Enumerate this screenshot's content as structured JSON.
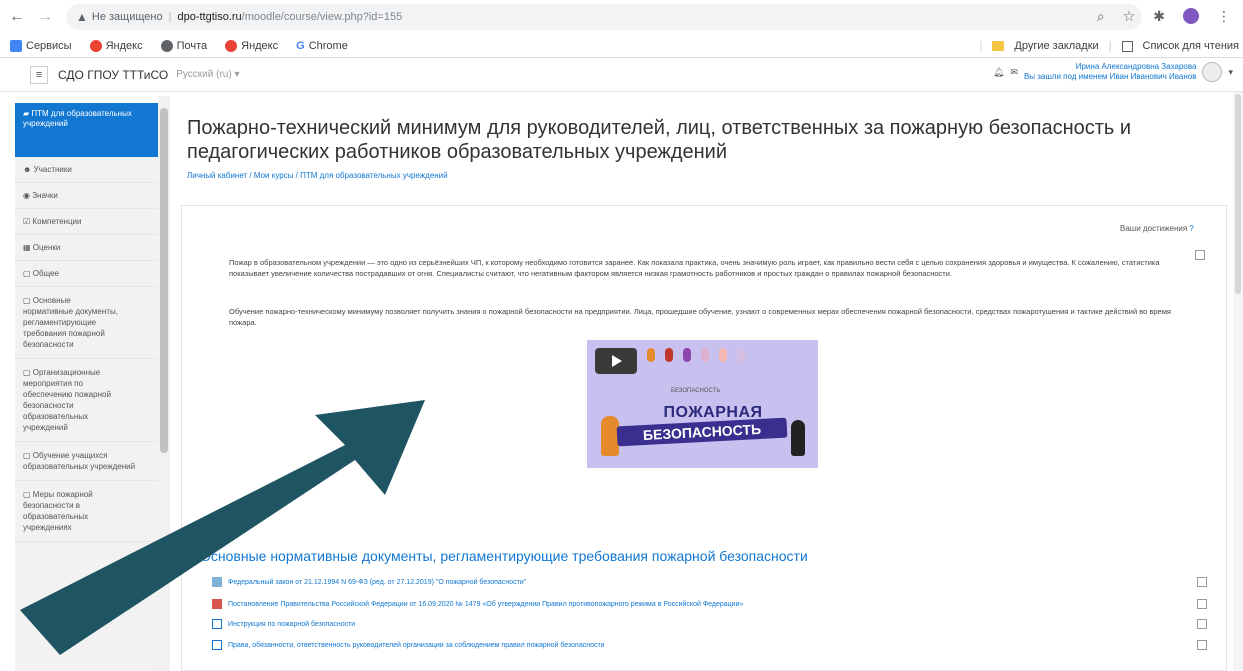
{
  "browser": {
    "nav": {
      "back": "←",
      "forward": "→",
      "reload": "C"
    },
    "security": "Не защищено",
    "host": "dpo-ttgtiso.ru",
    "path": "/moodle/course/view.php?id=155",
    "right_icons": [
      "zoom-icon",
      "star-icon",
      "pin-icon",
      "profile-icon",
      "menu-icon"
    ]
  },
  "bookmarks": {
    "items": [
      {
        "label": "Сервисы",
        "color": "#4285f4"
      },
      {
        "label": "Яндекс",
        "color": "#ea4335"
      },
      {
        "label": "Почта",
        "color": "#5f6368"
      },
      {
        "label": "Яндекс",
        "color": "#ea4335"
      },
      {
        "label": "Chrome",
        "color": "#34a853"
      }
    ],
    "other": "Другие закладки",
    "reading_list": "Список для чтения"
  },
  "navbar": {
    "site_name": "СДО ГПОУ ТТТиСО",
    "language": "Русский (ru) ▾",
    "user_line1": "Ирина Александровна Захарова",
    "user_line2": "Вы зашли под именем Иван Иванович Иванов"
  },
  "drawer": {
    "active": "ПТМ для образовательных учреждений",
    "items": [
      "Участники",
      "Значки",
      "Компетенции",
      "Оценки",
      "Общее",
      "Основные нормативные документы, регламентирующие требования пожарной безопасности",
      "Организационные мероприятия по обеспечению пожарной безопасности образовательных учреждений",
      "Обучение учащихся образовательных учреждений",
      "Меры пожарной безопасности в образовательных учреждениях"
    ]
  },
  "course": {
    "title": "Пожарно-технический минимум для руководителей, лиц, ответственных за пожарную безопасность и педагогических работников образовательных учреждений",
    "breadcrumb": "Личный кабинет / Мои курсы / ПТМ для образовательных учреждений",
    "progress_label": "Ваши достижения",
    "para1": "Пожар в образовательном учреждении — это одно из серьёзнейших ЧП, к которому необходимо готовится заранее. Как показала практика, очень значимую роль играет, как правильно вести себя с целью сохранения здоровья и имущества. К сожалению, статистика показывает увеличение количества пострадавших от огня. Специалисты считают, что негативным фактором является низкая грамотность работников и простых граждан о правилах пожарной безопасности.",
    "para2": "Обучение пожарно-техническому минимуму позволяет получить знания о пожарной безопасности на предприятии. Лица, прошедшие обучение, узнают о современных мерах обеспечения пожарной безопасности, средствах пожаротушения и тактике действий во время пожара.",
    "video": {
      "brand": "БЕЗОПАСНОСТЬ",
      "title_line1": "ПОЖАРНАЯ",
      "title_line2": "БЕЗОПАСНОСТЬ"
    },
    "section_title": "Основные нормативные документы, регламентирующие требования пожарной безопасности",
    "activities": [
      {
        "label": "Федеральный закон от 21.12.1994 N 69-ФЗ (ред. от 27.12.2019) \"О пожарной безопасности\"",
        "icon": "document-icon"
      },
      {
        "label": "Постановление Правительства Российской Федерации от 16.09.2020 № 1479 «Об утверждении Правил противопожарного режима в Российской Федерации»",
        "icon": "pdf-icon"
      },
      {
        "label": "Инструкция по пожарной безопасности",
        "icon": "file-icon"
      },
      {
        "label": "Права, обязанности, ответственность руководителей организации за соблюдением правил пожарной безопасности",
        "icon": "file-icon"
      }
    ]
  },
  "colors": {
    "accent": "#1177d1",
    "arrow": "#1f5563",
    "video_bg": "#c8c0ef"
  }
}
